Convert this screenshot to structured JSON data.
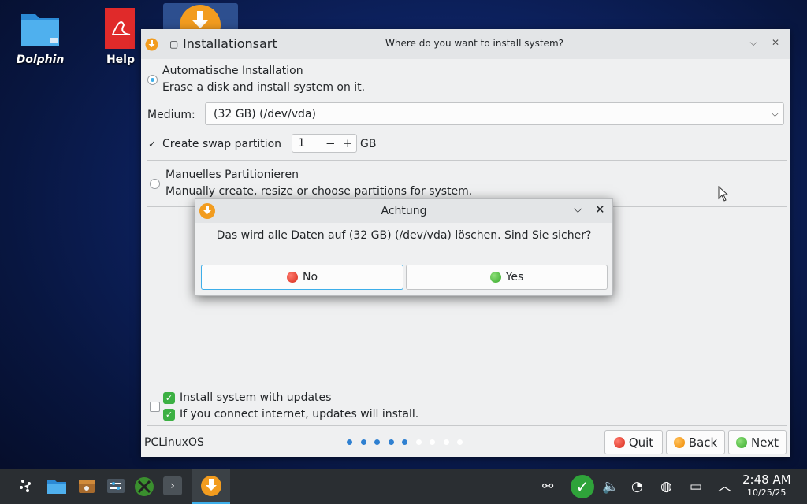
{
  "desktop": {
    "icons": [
      {
        "label": "Dolphin"
      },
      {
        "label": "Help"
      }
    ]
  },
  "window": {
    "title": "Installationsart",
    "subtitle": "Where do you want to install system?",
    "auto_install": {
      "label": "Automatische Installation",
      "desc": "Erase a disk and install system on it."
    },
    "medium": {
      "label": "Medium:",
      "value": "(32 GB) (/dev/vda)"
    },
    "swap": {
      "label": "Create swap partition",
      "value": "1",
      "unit": "GB"
    },
    "manual": {
      "label": "Manuelles Partitionieren",
      "desc": "Manually create, resize or choose partitions for system."
    },
    "updates": {
      "line1": "Install system with updates",
      "line2": "If you connect internet, updates will install."
    },
    "brand": "PCLinuxOS",
    "progress": {
      "total_steps": 9,
      "completed_steps": 5
    },
    "buttons": {
      "quit": "Quit",
      "back": "Back",
      "next": "Next"
    }
  },
  "dialog": {
    "title": "Achtung",
    "message": "Das wird alle Daten auf  (32 GB) (/dev/vda) löschen. Sind Sie sicher?",
    "no_label": "No",
    "yes_label": "Yes"
  },
  "taskbar": {
    "time": "2:48 AM",
    "date": "10/25/25"
  },
  "colors": {
    "accent": "#3daee9",
    "dot_active": "#2f80d1",
    "dot_inactive": "#ffffff"
  }
}
